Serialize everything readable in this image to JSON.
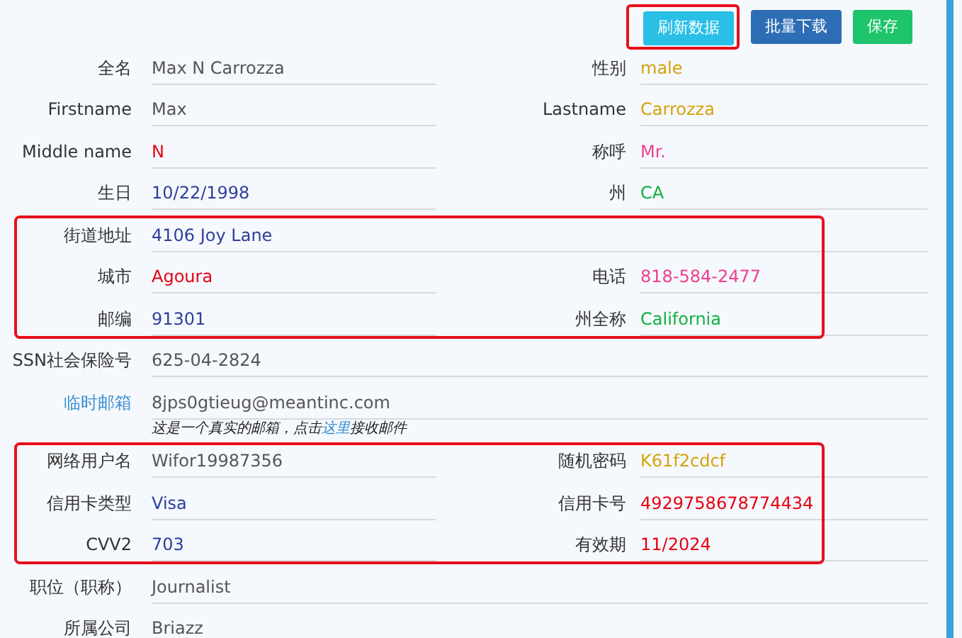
{
  "buttons": [
    {
      "label": "刷新数据",
      "color": "#29bfe6",
      "highlighted": true
    },
    {
      "label": "批量下载",
      "color": "#2d6db5",
      "highlighted": false
    },
    {
      "label": "保存",
      "color": "#1dc46b",
      "highlighted": false
    }
  ],
  "sections": [
    {
      "highlighted": false,
      "rows": [
        {
          "fields": [
            {
              "label": "全名",
              "value": "Max N Carrozza",
              "color": "#555555"
            },
            {
              "label": "性别",
              "value": "male",
              "color": "#d4a20a"
            }
          ]
        },
        {
          "fields": [
            {
              "label": "Firstname",
              "value": "Max",
              "color": "#555555"
            },
            {
              "label": "Lastname",
              "value": "Carrozza",
              "color": "#d4a20a"
            }
          ]
        },
        {
          "fields": [
            {
              "label": "Middle name",
              "value": "N",
              "color": "#e60012"
            },
            {
              "label": "称呼",
              "value": "Mr.",
              "color": "#ee3f8f"
            }
          ]
        },
        {
          "fields": [
            {
              "label": "生日",
              "value": "10/22/1998",
              "color": "#2e3f9a"
            },
            {
              "label": "州",
              "value": "CA",
              "color": "#12b040"
            }
          ]
        }
      ]
    },
    {
      "highlighted": true,
      "rows": [
        {
          "fields": [
            {
              "label": "街道地址",
              "value": "4106 Joy Lane",
              "color": "#2e3f9a"
            }
          ]
        },
        {
          "fields": [
            {
              "label": "城市",
              "value": "Agoura",
              "color": "#e60012"
            },
            {
              "label": "电话",
              "value": "818-584-2477",
              "color": "#ee3f8f"
            }
          ]
        },
        {
          "fields": [
            {
              "label": "邮编",
              "value": "91301",
              "color": "#2e3f9a"
            },
            {
              "label": "州全称",
              "value": "California",
              "color": "#12b040"
            }
          ]
        }
      ]
    },
    {
      "highlighted": false,
      "rows": [
        {
          "fields": [
            {
              "label": "SSN社会保险号",
              "value": "625-04-2824",
              "color": "#555555"
            }
          ]
        },
        {
          "fields": [
            {
              "label": "临时邮箱",
              "link": true,
              "value": "8jps0gtieug@meantinc.com",
              "color": "#555555"
            }
          ],
          "note": {
            "before": "这是一个真实的邮箱，点击",
            "link": "这里",
            "after": "接收邮件"
          }
        }
      ]
    },
    {
      "highlighted": true,
      "rows": [
        {
          "fields": [
            {
              "label": "网络用户名",
              "value": "Wifor19987356",
              "color": "#555555"
            },
            {
              "label": "随机密码",
              "value": "K61f2cdcf",
              "color": "#d4a20a"
            }
          ]
        },
        {
          "fields": [
            {
              "label": "信用卡类型",
              "value": "Visa",
              "color": "#2e3f9a"
            },
            {
              "label": "信用卡号",
              "value": "4929758678774434",
              "color": "#e60012"
            }
          ]
        },
        {
          "fields": [
            {
              "label": "CVV2",
              "value": "703",
              "color": "#2e3f9a"
            },
            {
              "label": "有效期",
              "value": "11/2024",
              "color": "#e60012"
            }
          ]
        }
      ]
    },
    {
      "highlighted": false,
      "rows": [
        {
          "fields": [
            {
              "label": "职位（职称）",
              "value": "Journalist",
              "color": "#555555"
            }
          ]
        },
        {
          "fields": [
            {
              "label": "所属公司",
              "value": "Briazz",
              "color": "#555555"
            }
          ]
        }
      ]
    }
  ]
}
